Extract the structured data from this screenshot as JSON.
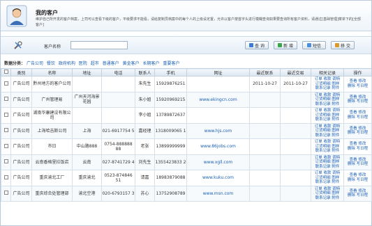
{
  "header": {
    "title": "我的客户",
    "description": "维护自己所开发的客户档案，上司可以查看下级的客户，平级要求不能看，请给复制员档案中的每个人的上级设定置，允许以客户按首字头进行模糊查询如果要查询所有客户资料，请通过[基础管理]菜单下的[全部客户]"
  },
  "search": {
    "label": "客户名称",
    "value": "",
    "buttons": [
      {
        "label": "查 询",
        "icon": "magnifier-icon",
        "color": "#3a7bd5"
      },
      {
        "label": "新 增",
        "icon": "add-icon",
        "color": "#3aa64a"
      },
      {
        "label": "短信",
        "icon": "sms-icon",
        "color": "#4a8fd9"
      },
      {
        "label": "移 交",
        "icon": "transfer-icon",
        "color": "#d99a2b"
      }
    ]
  },
  "categories": {
    "label": "数据分类：",
    "items": [
      "广告公司",
      "餐饮",
      "政府机构",
      "医院",
      "超市",
      "普通客户",
      "黄金客户",
      "长期客户",
      "重要客户"
    ]
  },
  "table": {
    "headers": [
      "",
      "类别",
      "名称",
      "地址",
      "电话",
      "联系人",
      "手机",
      "网址",
      "最近联系",
      "最近交易",
      "相关记录",
      "操作"
    ],
    "rows": [
      {
        "cat": "广告公司",
        "name": "黔州地方的客户公司",
        "addr": "",
        "tel": "",
        "contact": "朱先生",
        "mobile": "15929876251",
        "url": "",
        "last_contact": "2011-10-27",
        "last_deal": "2011-10-27"
      },
      {
        "cat": "广告公司",
        "name": "广州管理易",
        "addr": "广州天河海景花园",
        "tel": "",
        "contact": "朱小姐",
        "mobile": "15920969215",
        "url": "www.ekingcn.com",
        "last_contact": "",
        "last_deal": ""
      },
      {
        "cat": "广告公司",
        "name": "湖南华康建设有限公司",
        "addr": "",
        "tel": "",
        "contact": "李小姐",
        "mobile": "13789872637",
        "url": "",
        "last_contact": "",
        "last_deal": ""
      },
      {
        "cat": "广告公司",
        "name": "上海哈吉斯公司",
        "addr": "上海",
        "tel": "021-6917754 5",
        "contact": "嘉经理",
        "mobile": "1318009065 1",
        "url": "www.hjs.com",
        "last_contact": "",
        "last_deal": ""
      },
      {
        "cat": "广告公司",
        "name": "市日",
        "addr": "中山路888",
        "tel": "0754-888888 88",
        "contact": "老张",
        "mobile": "13899999999",
        "url": "www.86jobs.com",
        "last_contact": "",
        "last_deal": ""
      },
      {
        "cat": "广告公司",
        "name": "云南香格里拉饭店",
        "addr": "云南",
        "tel": "027-8741729 4",
        "contact": "刘先生",
        "mobile": "1355423833 2",
        "url": "www.xgll.com",
        "last_contact": "",
        "last_deal": ""
      },
      {
        "cat": "广告公司",
        "name": "重庆渝北工厂",
        "addr": "重庆渝北",
        "tel": "0523-874846 51",
        "contact": "请嘉",
        "mobile": "18983879088",
        "url": "www.kuku.com",
        "last_contact": "",
        "last_deal": ""
      },
      {
        "cat": "广告公司",
        "name": "重庆综合处管理部",
        "addr": "渝北空港",
        "tel": "020-6793157 3",
        "contact": "苏心",
        "mobile": "13752908789",
        "url": "www.msn.com",
        "last_contact": "",
        "last_deal": ""
      }
    ],
    "record_links": [
      "订单 收款 调特",
      "订货明细 图样",
      "联系记录 附件"
    ],
    "ops": [
      "查看 修改",
      "删除 写日程"
    ]
  }
}
